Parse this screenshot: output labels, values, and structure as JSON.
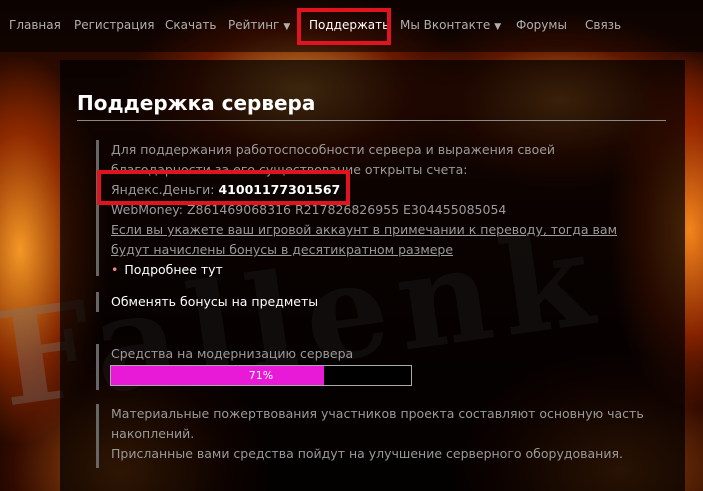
{
  "nav": {
    "items": [
      {
        "label": "Главная"
      },
      {
        "label": "Регистрация"
      },
      {
        "label": "Скачать"
      },
      {
        "label": "Рейтинг",
        "dropdown": "▼"
      },
      {
        "label": "Поддержать"
      },
      {
        "label": "Мы Вконтакте",
        "dropdown": "▼"
      },
      {
        "label": "Форумы"
      },
      {
        "label": "Связь"
      }
    ],
    "active": "Поддержать"
  },
  "background_text": "Fallenk",
  "page": {
    "title": "Поддержка сервера",
    "intro_line1": "Для поддержания работоспособности сервера и выражения своей",
    "intro_line2": "благодарности за его существование открыты счета:",
    "yandex_label": "Яндекс.Деньги:",
    "yandex_number": "41001177301567",
    "webmoney": "WebMoney: Z861469068316 R217826826955 E304455085054",
    "bonus_line1": "Если вы укажете ваш игровой аккаунт в примечании к переводу, тогда вам",
    "bonus_line2": "будут начислены бонусы в десятикратном размере",
    "more_link": "Подробнее тут",
    "exchange_link": "Обменять бонусы на предметы",
    "fund_label": "Средства на модернизацию сервера",
    "fund_percent_label": "71%",
    "fund_progress": 0.71,
    "note_line1": "Материальные пожертвования участников проекта составляют основную часть",
    "note_line2": "накоплений.",
    "note_line3": "Присланные вами средства пойдут на улучшение серверного оборудования."
  },
  "colors": {
    "highlight_box": "#e0141e",
    "progress_fill": "#e81ad8"
  }
}
